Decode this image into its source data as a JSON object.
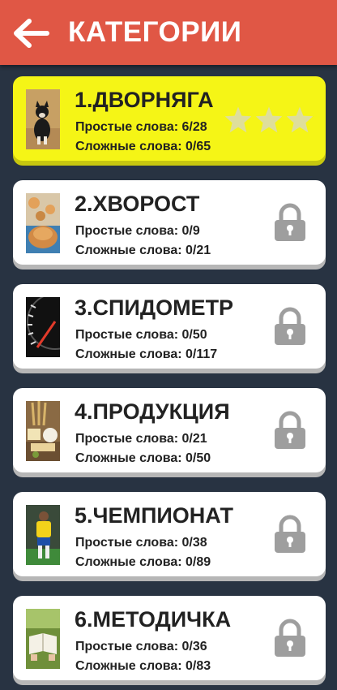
{
  "header": {
    "title": "КАТЕГОРИИ",
    "back_icon": "arrow-left-icon"
  },
  "colors": {
    "header": "#e05745",
    "background": "#283342",
    "active_card": "#f5f516",
    "card": "#ffffff",
    "star": "#dede9c",
    "lock": "#9e9e9e"
  },
  "categories": [
    {
      "title": "1.ДВОРНЯГА",
      "simple": "Простые слова: 6/28",
      "complex": "Сложные слова: 0/65",
      "status": "unlocked",
      "stars": 3
    },
    {
      "title": "2.ХВОРОСТ",
      "simple": "Простые слова: 0/9",
      "complex": "Сложные слова: 0/21",
      "status": "locked"
    },
    {
      "title": "3.СПИДОМЕТР",
      "simple": "Простые слова: 0/50",
      "complex": "Сложные слова: 0/117",
      "status": "locked"
    },
    {
      "title": "4.ПРОДУКЦИЯ",
      "simple": "Простые слова: 0/21",
      "complex": "Сложные слова: 0/50",
      "status": "locked"
    },
    {
      "title": "5.ЧЕМПИОНАТ",
      "simple": "Простые слова: 0/38",
      "complex": "Сложные слова: 0/89",
      "status": "locked"
    },
    {
      "title": "6.МЕТОДИЧКА",
      "simple": "Простые слова: 0/36",
      "complex": "Сложные слова: 0/83",
      "status": "locked"
    }
  ]
}
